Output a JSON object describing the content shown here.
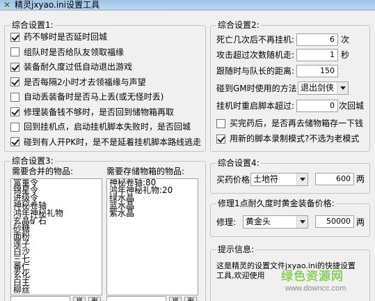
{
  "window": {
    "title": "精灵jxyao.ini设置工具"
  },
  "general1": {
    "title": "综合设置1:",
    "options": [
      {
        "label": "药不够时是否延时回城",
        "checked": true
      },
      {
        "label": "组队时是否给队友领取福缘",
        "checked": false
      },
      {
        "label": "装备耐久度过低自动退出游戏",
        "checked": true
      },
      {
        "label": "是否每隔2小时才去领福缘与声望",
        "checked": true
      },
      {
        "label": "自动丢装备时是否马上丢(或无怪时丢)",
        "checked": false
      },
      {
        "label": "修理装备钱不够时，是否回到储物箱再取",
        "checked": true
      },
      {
        "label": "回到挂机点，启动挂机脚本失败时，是否回城",
        "checked": false
      },
      {
        "label": "碰到有人开PK时，是不是延着挂机脚本路线逃走",
        "checked": true
      }
    ]
  },
  "general2": {
    "title": "综合设置2:",
    "death_label": "死亡几次后不再挂机:",
    "death_value": "6",
    "death_unit": "次",
    "attack_label": "攻击超过次数随机走:",
    "attack_value": "1",
    "attack_unit": "秒",
    "follow_label": "跟随时与队长的距离:",
    "follow_value": "150",
    "gm_label": "碰到GM时使用的方法:",
    "gm_method": "退出剑侠",
    "restart_label": "挂机时重启脚本超过:",
    "restart_value": "0",
    "restart_unit": "次回城",
    "buy_medicine_label": "买完药后，是否再去储物箱存一下钱",
    "buy_medicine_checked": false,
    "new_script_label": "用新的脚本录制模式?不选为老模式",
    "new_script_checked": true
  },
  "general3": {
    "title": "综合设置3:",
    "merge_label": "需要合并的物品:",
    "merge_items": [
      "富董令",
      "锦星令",
      "进级令",
      "神秘卷轴",
      "鸿年神秘礼物",
      "玄晶矿石",
      "砂糖",
      "面粉",
      "莲子",
      "白沙",
      "三七",
      "番仁",
      "玄化",
      "白主",
      "柳丝"
    ],
    "store_label": "需要存储物箱的物品:",
    "store_items": [
      "神秘卷轴:80",
      "鸿年神秘礼物:20",
      "绿水晶",
      "蓝水晶",
      "紫水晶"
    ],
    "add_button": "增",
    "delete_button": "删"
  },
  "general4": {
    "title": "综合设置4:",
    "medicine_label": "买药价格",
    "medicine_type": "土地符",
    "medicine_price": "600",
    "medicine_unit": "两"
  },
  "repair": {
    "title": "修理1点耐久度时黄金装备价格:",
    "repair_label": "修理:",
    "repair_type": "黄金头",
    "repair_price": "50000",
    "repair_unit": "两"
  },
  "tips": {
    "title": "提示信息:",
    "text": "这是精灵的设置文件jxyao.ini的快捷设置工具,欢迎使用"
  },
  "watermark": {
    "title": "绿色资源网",
    "url": "www.downcc.com"
  },
  "icons": {
    "app": "app-icon",
    "dropdown": "chevron-down-icon"
  }
}
